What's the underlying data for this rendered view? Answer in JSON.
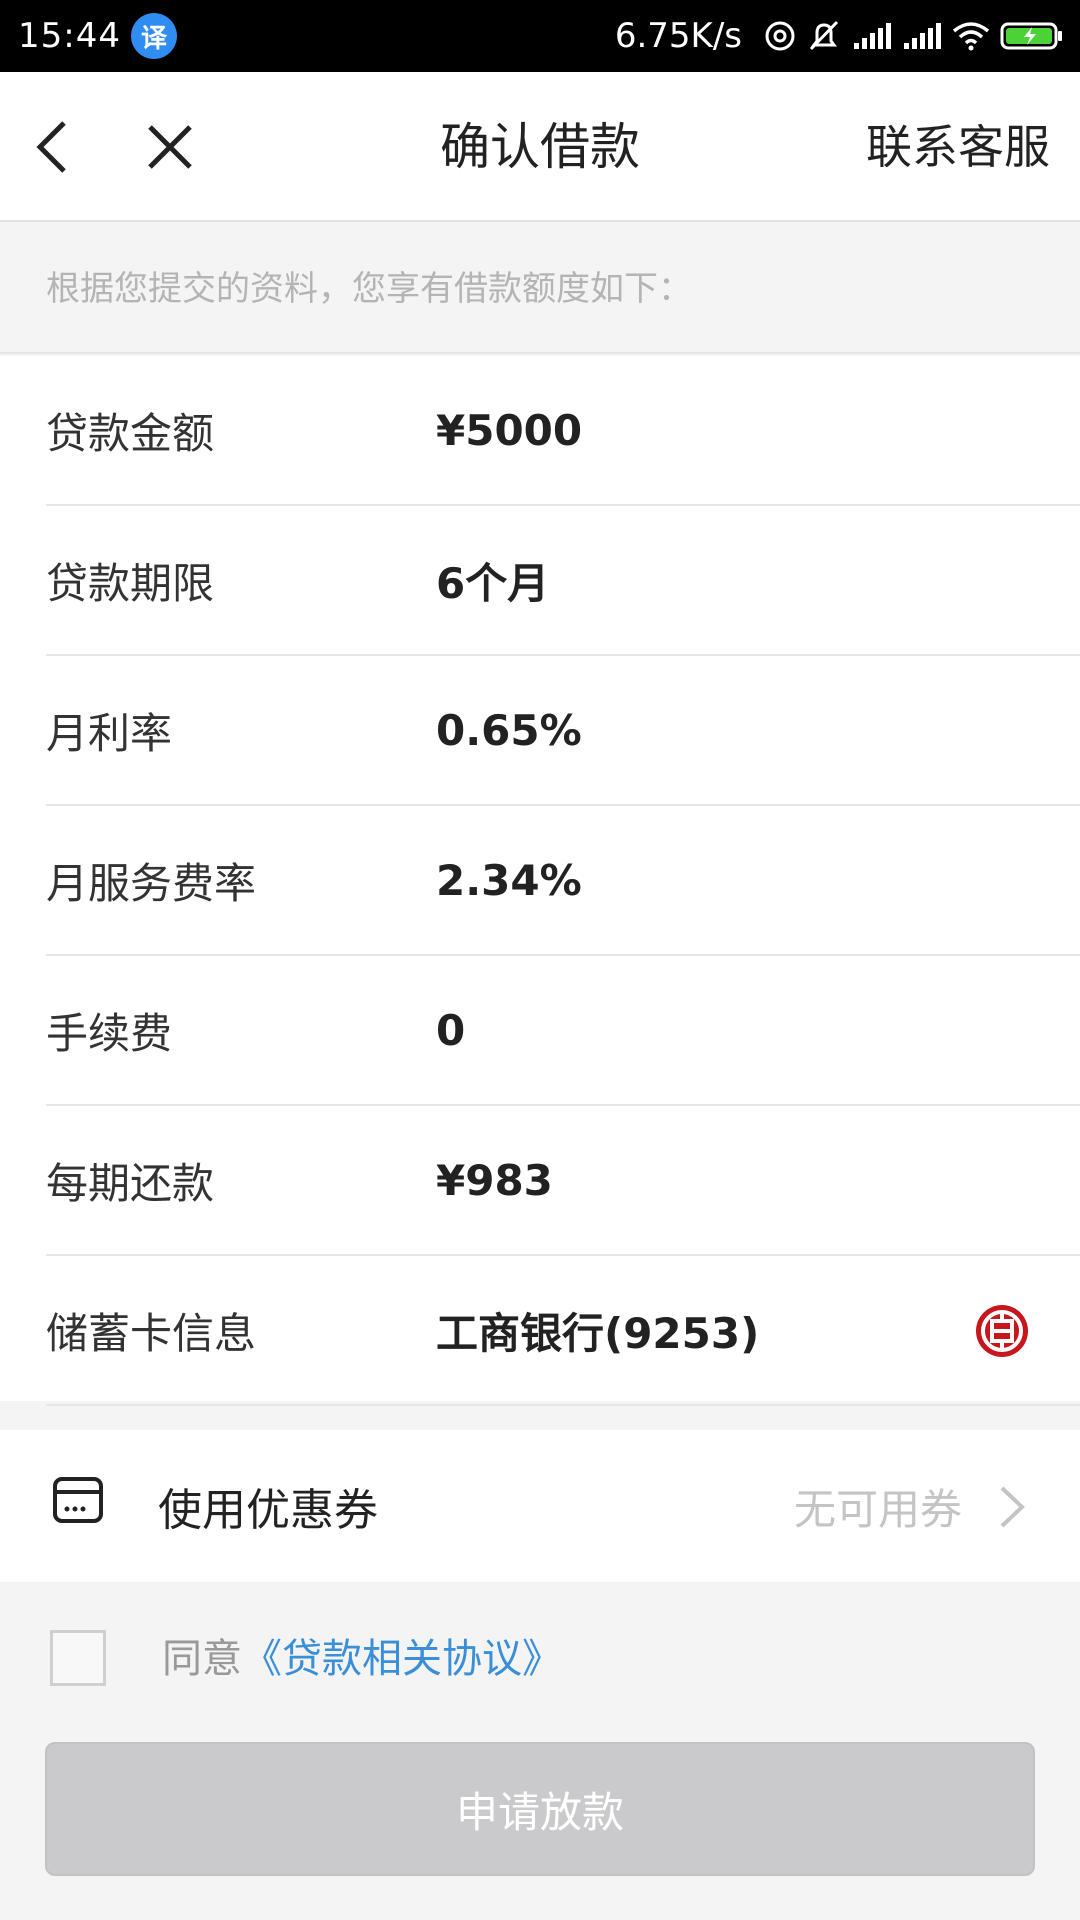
{
  "status_bar": {
    "time": "15:44",
    "translate_badge": "译",
    "net_speed": "6.75K/s"
  },
  "nav": {
    "title": "确认借款",
    "service_label": "联系客服"
  },
  "hint": "根据您提交的资料，您享有借款额度如下：",
  "details": [
    {
      "label": "贷款金额",
      "value": "¥5000"
    },
    {
      "label": "贷款期限",
      "value": "6个月"
    },
    {
      "label": "月利率",
      "value": "0.65%"
    },
    {
      "label": "月服务费率",
      "value": "2.34%"
    },
    {
      "label": "手续费",
      "value": "0"
    },
    {
      "label": "每期还款",
      "value": "¥983"
    },
    {
      "label": "储蓄卡信息",
      "value": "工商银行(9253)",
      "bank_icon": "icbc-logo-icon"
    }
  ],
  "coupon": {
    "label": "使用优惠券",
    "status": "无可用券"
  },
  "agreement": {
    "prefix": "同意",
    "link": "《贷款相关协议》"
  },
  "submit_label": "申请放款",
  "colors": {
    "link": "#3b8fd8",
    "bank_red": "#c8161d",
    "disabled_button": "#cacacc"
  }
}
